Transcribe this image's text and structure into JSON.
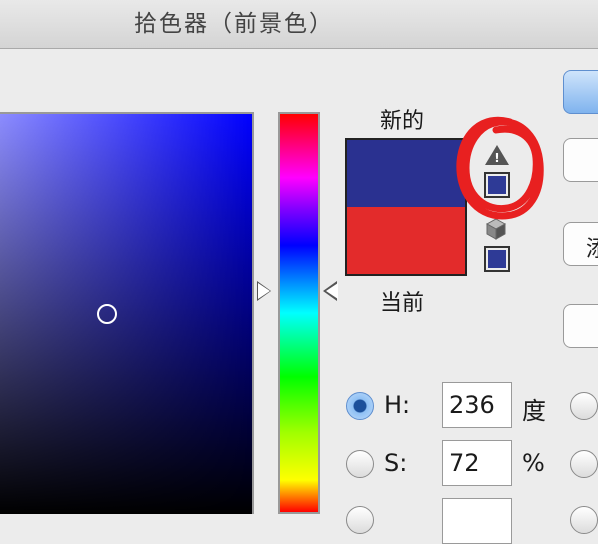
{
  "window": {
    "title": "拾色器（前景色）"
  },
  "swatch": {
    "new_label": "新的",
    "current_label": "当前",
    "new_color": "#2a3190",
    "current_color": "#e32b2b",
    "websafe_color": "#2e3a96"
  },
  "colors": {
    "annotation": "#e82020",
    "accent": "#5f8fcf"
  },
  "buttons": {
    "ok_label": "",
    "cancel_label": "",
    "add_to_swatches_label": "添",
    "color_libraries_label": ""
  },
  "hsb": {
    "h": {
      "label": "H:",
      "value": "236",
      "unit": "度",
      "selected": true
    },
    "s": {
      "label": "S:",
      "value": "72",
      "unit": "%",
      "selected": false
    }
  },
  "icons": [
    "warning-icon",
    "websafe-cube-icon",
    "radio-icon"
  ]
}
